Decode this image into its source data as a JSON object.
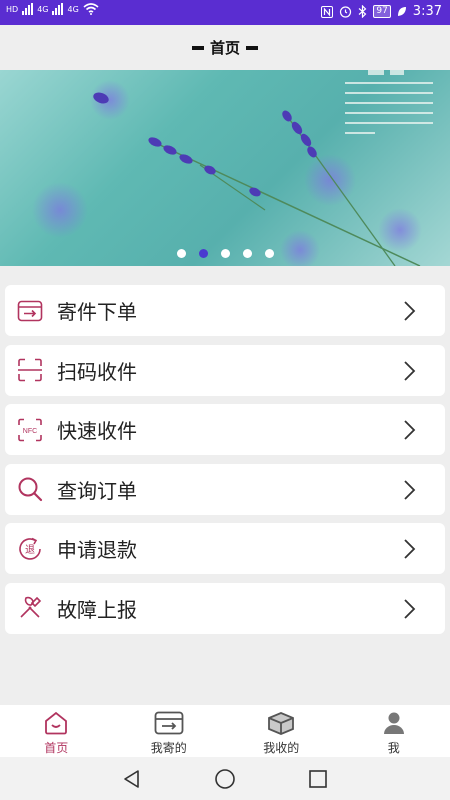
{
  "status_bar": {
    "left_labels": [
      "HD",
      "4G",
      "4G"
    ],
    "battery": "97",
    "time": "3:37"
  },
  "header": {
    "title": "首页"
  },
  "banner": {
    "slide_count": 5,
    "active_index": 1
  },
  "menu": {
    "items": [
      {
        "label": "寄件下单",
        "icon": "send-box-icon"
      },
      {
        "label": "扫码收件",
        "icon": "scan-icon"
      },
      {
        "label": "快速收件",
        "icon": "nfc-icon",
        "icon_text": "NFC"
      },
      {
        "label": "查询订单",
        "icon": "search-icon"
      },
      {
        "label": "申请退款",
        "icon": "refund-icon",
        "icon_text": "退"
      },
      {
        "label": "故障上报",
        "icon": "tools-icon"
      }
    ]
  },
  "bottom_nav": {
    "tabs": [
      {
        "label": "首页",
        "icon": "home-icon",
        "active": true
      },
      {
        "label": "我寄的",
        "icon": "send-box-icon",
        "active": false
      },
      {
        "label": "我收的",
        "icon": "package-icon",
        "active": false
      },
      {
        "label": "我",
        "icon": "user-icon",
        "active": false
      }
    ]
  },
  "colors": {
    "status_bar": "#5a2dd1",
    "accent": "#b1345f",
    "active_dot": "#4a3ad0"
  }
}
